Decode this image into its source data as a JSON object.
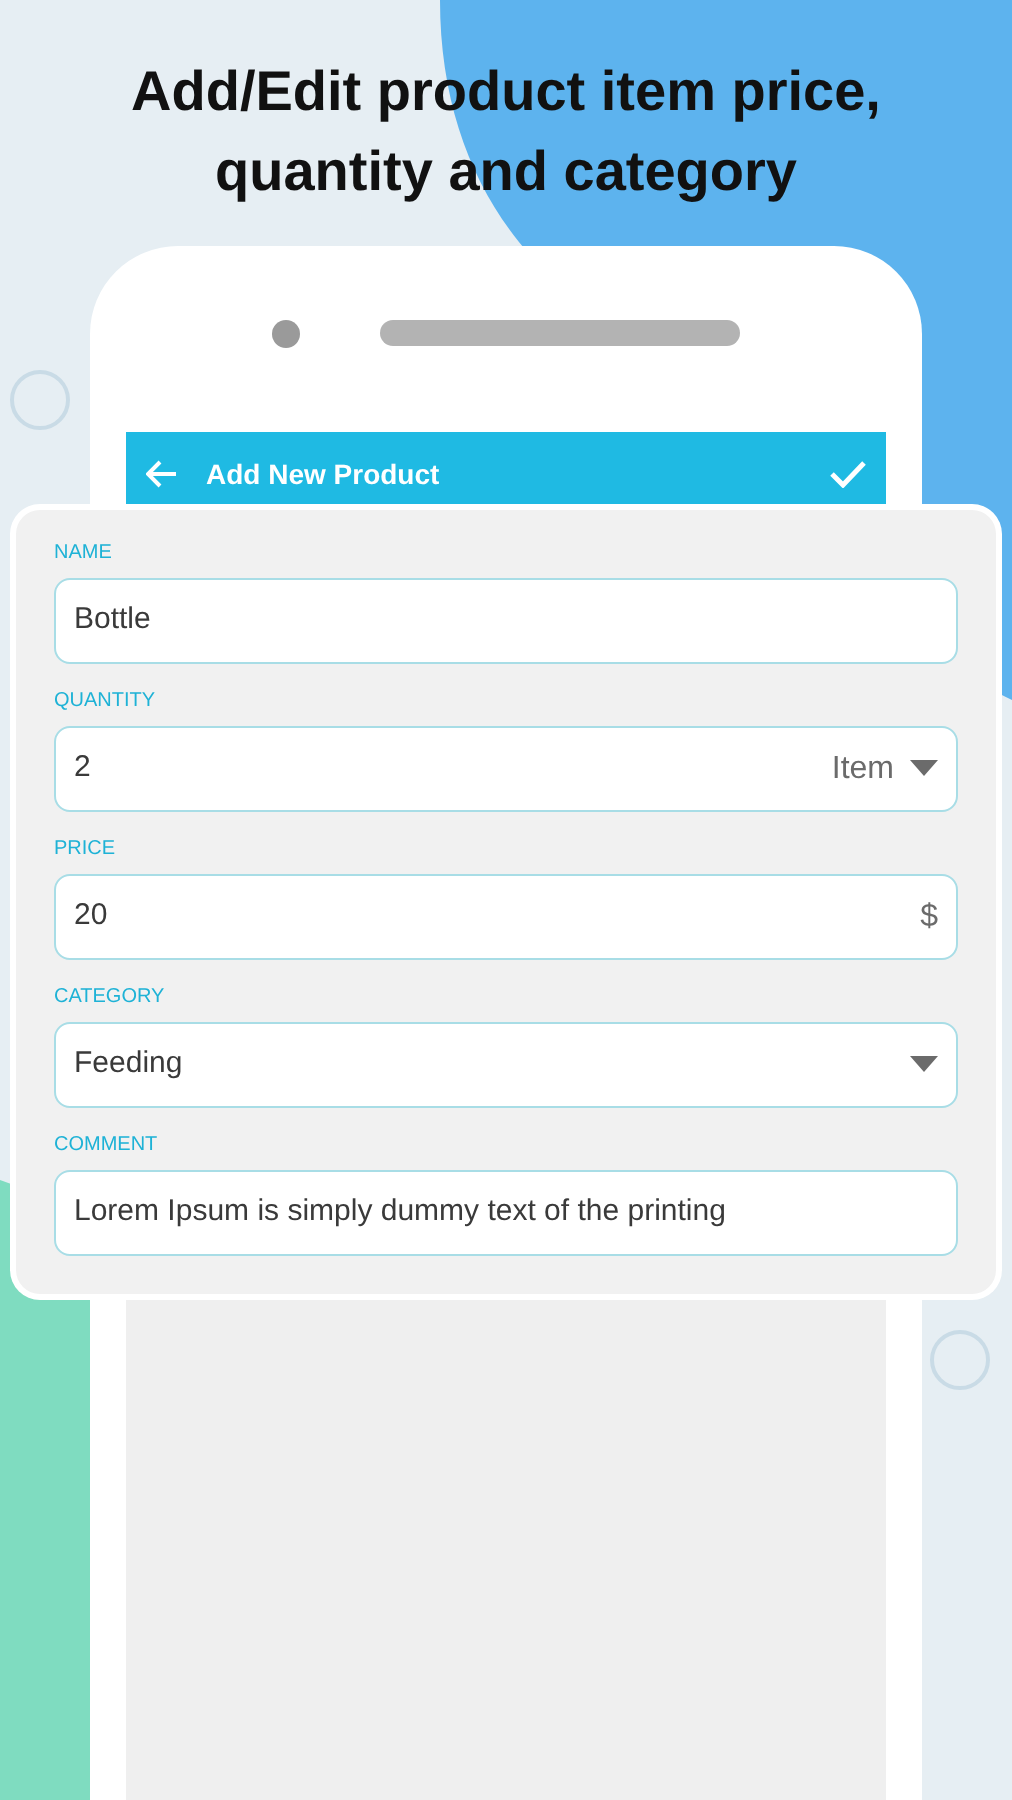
{
  "headline": "Add/Edit product item price, quantity and category",
  "toolbar": {
    "title": "Add New Product"
  },
  "fields": [
    {
      "label": "NAME",
      "value": "Bottle",
      "kind": "text"
    },
    {
      "label": "QUANTITY",
      "value": "2",
      "kind": "unit-select",
      "suffix": "Item"
    },
    {
      "label": "PRICE",
      "value": "20",
      "kind": "suffix",
      "suffix": "$"
    },
    {
      "label": "CATEGORY",
      "value": "Feeding",
      "kind": "select"
    },
    {
      "label": "COMMENT",
      "value": "Lorem Ipsum is simply dummy text of the printing",
      "kind": "text"
    }
  ]
}
